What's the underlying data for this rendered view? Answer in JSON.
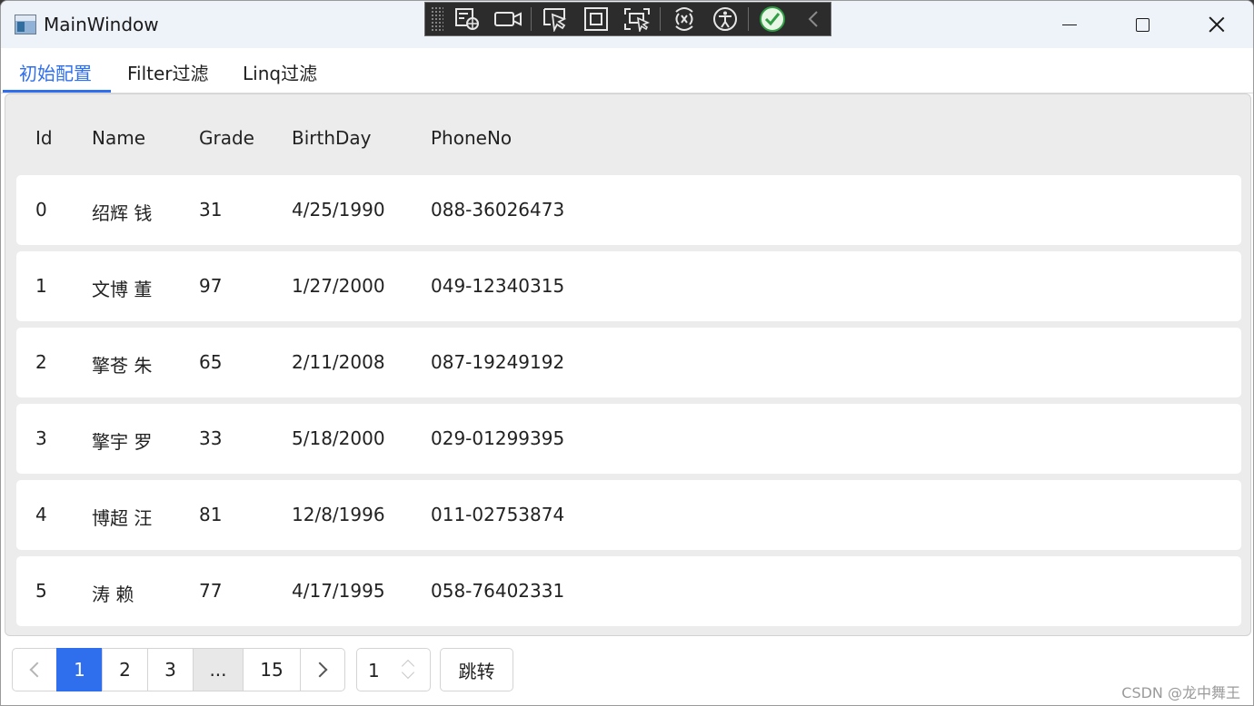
{
  "window": {
    "title": "MainWindow"
  },
  "tabs": [
    {
      "label": "初始配置",
      "active": true
    },
    {
      "label": "Filter过滤",
      "active": false
    },
    {
      "label": "Linq过滤",
      "active": false
    }
  ],
  "table": {
    "columns": [
      "Id",
      "Name",
      "Grade",
      "BirthDay",
      "PhoneNo"
    ],
    "rows": [
      {
        "id": "0",
        "name": "绍辉 钱",
        "grade": "31",
        "birthday": "4/25/1990",
        "phone": "088-36026473"
      },
      {
        "id": "1",
        "name": "文博 董",
        "grade": "97",
        "birthday": "1/27/2000",
        "phone": "049-12340315"
      },
      {
        "id": "2",
        "name": "擎苍 朱",
        "grade": "65",
        "birthday": "2/11/2008",
        "phone": "087-19249192"
      },
      {
        "id": "3",
        "name": "擎宇 罗",
        "grade": "33",
        "birthday": "5/18/2000",
        "phone": "029-01299395"
      },
      {
        "id": "4",
        "name": "博超 汪",
        "grade": "81",
        "birthday": "12/8/1996",
        "phone": "011-02753874"
      },
      {
        "id": "5",
        "name": "涛 赖",
        "grade": "77",
        "birthday": "4/17/1995",
        "phone": "058-76402331"
      }
    ]
  },
  "pager": {
    "pages": [
      "1",
      "2",
      "3",
      "...",
      "15"
    ],
    "current_page": "1",
    "jump_value": "1",
    "jump_label": "跳转"
  },
  "watermark": "CSDN @龙中舞王",
  "colors": {
    "accent": "#2f6fed",
    "ok_green": "#2f9e44"
  },
  "icons": {
    "debug_toolbar": [
      "select-element-icon",
      "video-camera-icon",
      "cursor-select-icon",
      "square-frame-icon",
      "display-layout-icon",
      "hot-reload-icon",
      "accessibility-icon",
      "checkmark-circle-icon",
      "chevron-left-icon"
    ]
  }
}
